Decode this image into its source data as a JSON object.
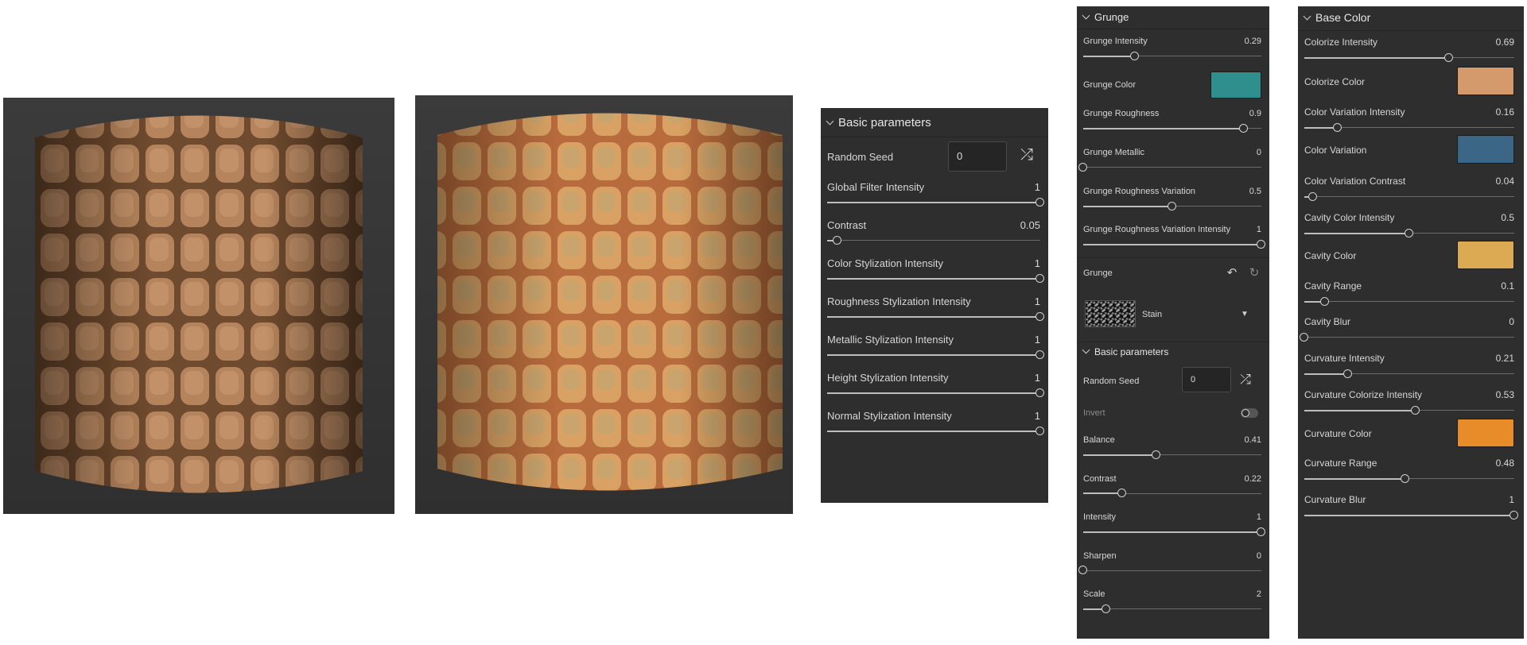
{
  "colors": {
    "panel_bg": "#2e2e2e",
    "grunge_color": "#2e8f8c",
    "colorize_color": "#d59a6c",
    "color_variation": "#3b6685",
    "cavity_color": "#dcaa52",
    "curvature_color": "#e88c2a"
  },
  "panel1": {
    "title": "Basic parameters",
    "random_seed": {
      "label": "Random Seed",
      "value": "0",
      "icon": "shuffle-icon"
    },
    "sliders": [
      {
        "label": "Global Filter Intensity",
        "value": "1",
        "fraction": 1
      },
      {
        "label": "Contrast",
        "value": "0.05",
        "fraction": 0.05
      },
      {
        "label": "Color Stylization Intensity",
        "value": "1",
        "fraction": 1
      },
      {
        "label": "Roughness Stylization Intensity",
        "value": "1",
        "fraction": 1
      },
      {
        "label": "Metallic Stylization Intensity",
        "value": "1",
        "fraction": 1
      },
      {
        "label": "Height Stylization Intensity",
        "value": "1",
        "fraction": 1
      },
      {
        "label": "Normal Stylization Intensity",
        "value": "1",
        "fraction": 1
      }
    ]
  },
  "panel2": {
    "title": "Grunge",
    "grunge_intensity": {
      "label": "Grunge Intensity",
      "value": "0.29",
      "fraction": 0.29
    },
    "grunge_color": {
      "label": "Grunge Color"
    },
    "grunge_roughness": {
      "label": "Grunge Roughness",
      "value": "0.9",
      "fraction": 0.9
    },
    "grunge_metallic": {
      "label": "Grunge Metallic",
      "value": "0",
      "fraction": 0
    },
    "grunge_roughness_variation": {
      "label": "Grunge Roughness Variation",
      "value": "0.5",
      "fraction": 0.5
    },
    "grunge_roughness_variation_intensity": {
      "label": "Grunge Roughness Variation Intensity",
      "value": "1",
      "fraction": 1
    },
    "grunge_resource": {
      "label": "Grunge",
      "selected": "Stain",
      "icons": [
        "reset-icon",
        "refresh-icon"
      ]
    },
    "basic_title": "Basic parameters",
    "random_seed": {
      "label": "Random Seed",
      "value": "0",
      "icon": "shuffle-icon"
    },
    "invert": {
      "label": "Invert",
      "on": false
    },
    "sliders": [
      {
        "label": "Balance",
        "value": "0.41",
        "fraction": 0.41
      },
      {
        "label": "Contrast",
        "value": "0.22",
        "fraction": 0.22
      },
      {
        "label": "Intensity",
        "value": "1",
        "fraction": 1
      },
      {
        "label": "Sharpen",
        "value": "0",
        "fraction": 0
      },
      {
        "label": "Scale",
        "value": "2",
        "fraction": 0.13
      }
    ]
  },
  "panel3": {
    "title": "Base Color",
    "colorize_intensity": {
      "label": "Colorize Intensity",
      "value": "0.69",
      "fraction": 0.69
    },
    "colorize_color": {
      "label": "Colorize Color"
    },
    "color_variation_intensity": {
      "label": "Color Variation Intensity",
      "value": "0.16",
      "fraction": 0.16
    },
    "color_variation": {
      "label": "Color Variation"
    },
    "color_variation_contrast": {
      "label": "Color Variation Contrast",
      "value": "0.04",
      "fraction": 0.04
    },
    "cavity_color_intensity": {
      "label": "Cavity Color Intensity",
      "value": "0.5",
      "fraction": 0.5
    },
    "cavity_color": {
      "label": "Cavity Color"
    },
    "cavity_range": {
      "label": "Cavity Range",
      "value": "0.1",
      "fraction": 0.1
    },
    "cavity_blur": {
      "label": "Cavity Blur",
      "value": "0",
      "fraction": 0
    },
    "curvature_intensity": {
      "label": "Curvature Intensity",
      "value": "0.21",
      "fraction": 0.21
    },
    "curvature_colorize_intensity": {
      "label": "Curvature Colorize Intensity",
      "value": "0.53",
      "fraction": 0.53
    },
    "curvature_color": {
      "label": "Curvature Color"
    },
    "curvature_range": {
      "label": "Curvature Range",
      "value": "0.48",
      "fraction": 0.48
    },
    "curvature_blur": {
      "label": "Curvature Blur",
      "value": "1",
      "fraction": 1
    }
  }
}
